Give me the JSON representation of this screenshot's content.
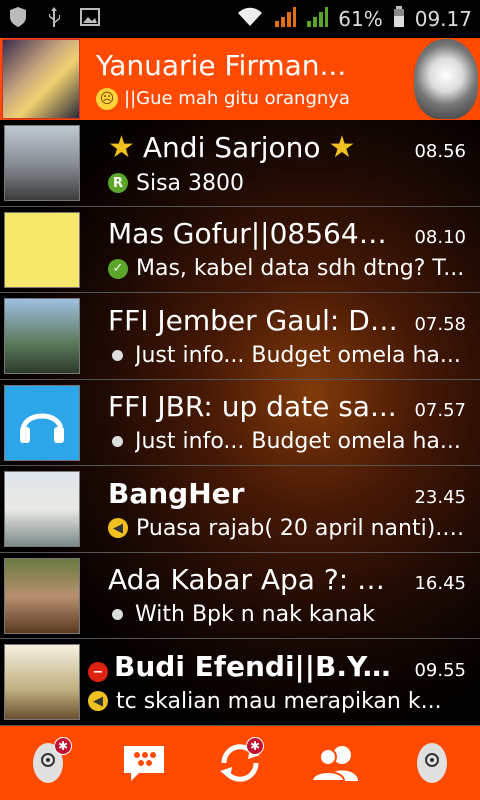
{
  "statusbar": {
    "battery": "61%",
    "time": "09.17"
  },
  "profile": {
    "name": "Yanuarie Firman...",
    "status": "||Gue mah gitu orangnya"
  },
  "chats": [
    {
      "title": "Andi Sarjono",
      "time": "08.56",
      "message": "Sisa 3800",
      "indicator": "R"
    },
    {
      "title": "Mas Gofur||085649...",
      "time": "08.10",
      "message": "Mas, kabel data sdh dtng? T...",
      "indicator": "✓"
    },
    {
      "title": "FFI Jember Gaul: Di...",
      "time": "07.58",
      "message": "Just info... Budget omela ha...",
      "indicator": ""
    },
    {
      "title": "FFI JBR: up date sa...",
      "time": "07.57",
      "message": "Just info... Budget omela ha...",
      "indicator": ""
    },
    {
      "title": "BangHer",
      "time": "23.45",
      "message": "Puasa rajab( 20 april nanti). ...",
      "indicator": ""
    },
    {
      "title": "Ada Kabar Apa ?: K...",
      "time": "16.45",
      "message": "With Bpk n nak kanak",
      "indicator": ""
    },
    {
      "title": "Budi Efendi||B.Y.E™",
      "time": "09.55",
      "message": "tc skalian mau merapikan k...",
      "indicator": ""
    }
  ],
  "colors": {
    "accent": "#ff4a00",
    "status_green": "#5aa52a",
    "status_yellow": "#f0c020",
    "status_red": "#d21"
  },
  "icons": {
    "nav": [
      "mask-icon",
      "bbm-chat-icon",
      "sync-icon",
      "contacts-icon",
      "mask-icon"
    ]
  }
}
